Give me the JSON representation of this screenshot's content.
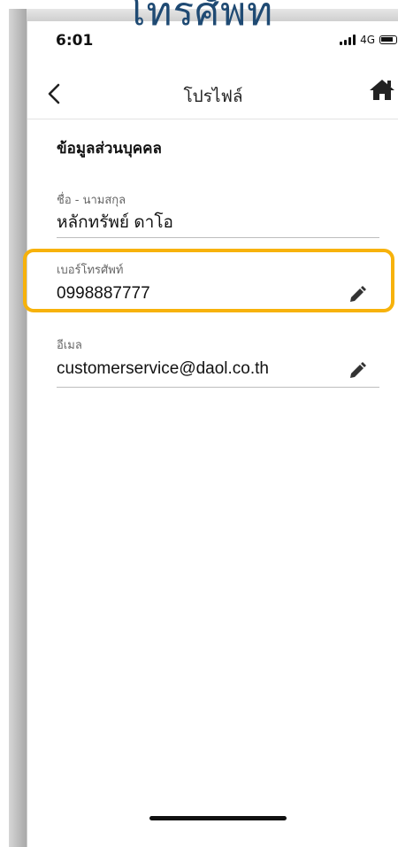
{
  "banner_fragment": "โทรศัพท",
  "status_bar": {
    "time": "6:01",
    "network": "4G"
  },
  "nav": {
    "title": "โปรไฟล์",
    "back_icon": "chevron-left-icon",
    "home_icon": "home-icon"
  },
  "section": {
    "title": "ข้อมูลส่วนบุคคล"
  },
  "fields": [
    {
      "label": "ชื่อ - นามสกุล",
      "value": "หลักทรัพย์ ดาโอ",
      "editable": false
    },
    {
      "label": "เบอร์โทรศัพท์",
      "value": "0998887777",
      "editable": true,
      "edit_icon": "pencil-icon"
    },
    {
      "label": "อีเมล",
      "value": "customerservice@daol.co.th",
      "editable": true,
      "edit_icon": "pencil-icon"
    }
  ],
  "colors": {
    "highlight": "#f7b20b",
    "banner_text": "#1f4a73"
  }
}
